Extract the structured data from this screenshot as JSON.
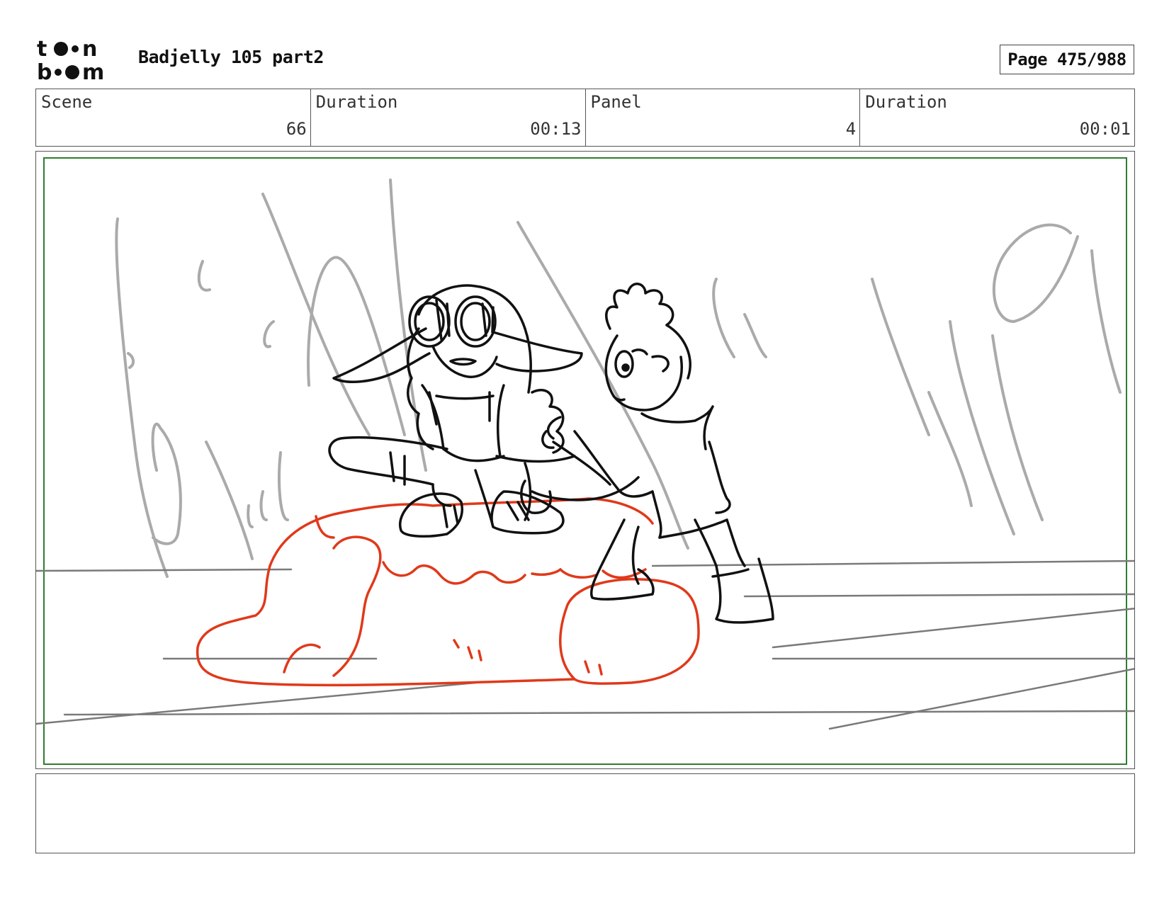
{
  "header": {
    "logo_text": "toon boom",
    "title": "Badjelly 105 part2",
    "page_label": "Page 475/988"
  },
  "info": {
    "scene_label": "Scene",
    "scene_value": "66",
    "scene_duration_label": "Duration",
    "scene_duration_value": "00:13",
    "panel_label": "Panel",
    "panel_value": "4",
    "panel_duration_label": "Duration",
    "panel_duration_value": "00:01"
  },
  "panel": {
    "safe_frame_color": "#2e7d32",
    "rock_color": "#e0391a",
    "background_sketch_color": "#aaaaaa",
    "ground_line_color": "#7a7a7a",
    "character_line_color": "#111111"
  },
  "notes": {
    "text": ""
  }
}
